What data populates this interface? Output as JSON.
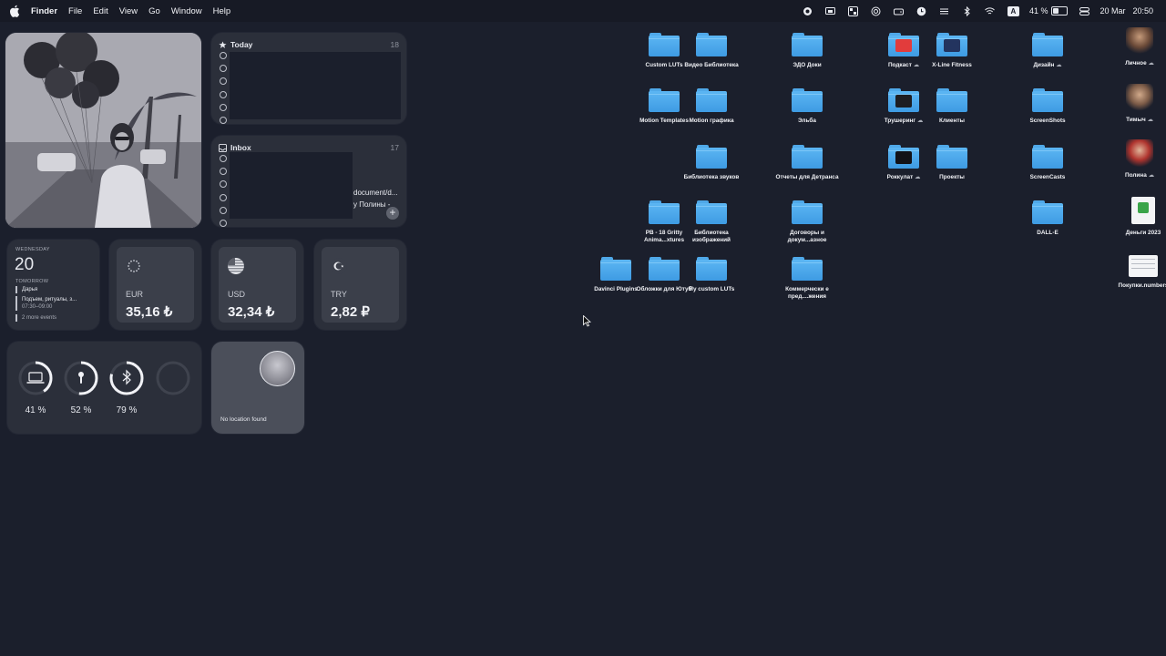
{
  "menubar": {
    "app": "Finder",
    "items": [
      "File",
      "Edit",
      "View",
      "Go",
      "Window",
      "Help"
    ],
    "battery": "41 %",
    "date": "20 Mar",
    "time": "20:50",
    "keyboard": "A"
  },
  "todo_today": {
    "title": "Today",
    "count": "18"
  },
  "todo_inbox": {
    "title": "Inbox",
    "count": "17",
    "frag1": "document/d...",
    "frag2": "у Полины -"
  },
  "calendar": {
    "weekday": "WEDNESDAY",
    "day": "20",
    "tomorrow": "TOMORROW",
    "events": [
      "Дарья",
      "Подъем, ритуалы, з...",
      "07:30–09:00"
    ],
    "more": "2 more events"
  },
  "currencies": [
    {
      "code": "EUR",
      "value": "35,16 ₺"
    },
    {
      "code": "USD",
      "value": "32,34 ₺"
    },
    {
      "code": "TRY",
      "value": "2,82 ₽"
    }
  ],
  "batteries": [
    {
      "device": "laptop-icon",
      "label": "41 %",
      "level": 0.41
    },
    {
      "device": "airpods-icon",
      "label": "52 %",
      "level": 0.52
    },
    {
      "device": "bluetooth-icon",
      "label": "79 %",
      "level": 0.79
    },
    {
      "device": "empty",
      "label": "",
      "level": 0
    }
  ],
  "location": {
    "text": "No location found"
  },
  "desktop": {
    "custom_luts": "Custom LUTs",
    "video_lib": "Видео Библиотека",
    "edo": "ЭДО Доки",
    "podcast": "Подкаст",
    "xline": "X-Line Fitness",
    "design": "Дизайн",
    "personal": "Личное",
    "motion_templates": "Motion Templates",
    "motion_graphics": "Motion графика",
    "elba": "Эльба",
    "trusher": "Трушеринг",
    "clients": "Клиенты",
    "screenshots": "ScreenShots",
    "timych": "Тимыч",
    "sound_lib": "Библиотека звуков",
    "reports": "Отчеты для Детранса",
    "rockulat": "Роккулат",
    "projects": "Проекты",
    "screencasts": "ScreenCasts",
    "polina": "Полина",
    "pb18": "PB - 18 Gritty Anima...xtures",
    "image_lib": "Библиотека изображений",
    "contracts": "Договоры и докум...азное",
    "dalle": "DALL-E",
    "money": "Деньги 2023",
    "davinci": "Davinci Plugins",
    "covers": "Обложки для Ютуб",
    "my_luts": "My custom LUTs",
    "commercial": "Коммерчески е пред....жения",
    "purchases": "Покупки.numbers"
  },
  "colors": {
    "desktop": "#1b1f2c",
    "folder": "#4aa6ea",
    "widget": "#2b2f3a"
  }
}
